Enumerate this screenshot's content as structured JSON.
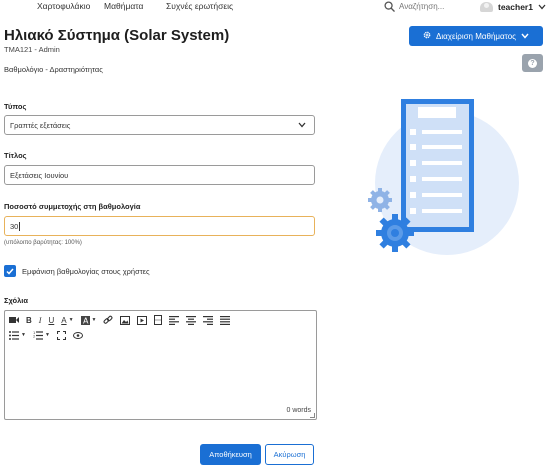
{
  "topnav": {
    "items": [
      {
        "label": "Χαρτοφυλάκιο"
      },
      {
        "label": "Μαθήματα"
      },
      {
        "label": "Συχνές ερωτήσεις"
      }
    ],
    "search_placeholder": "Αναζήτηση...",
    "search_icon": "search-icon",
    "username": "teacher1"
  },
  "header": {
    "title": "Ηλιακό Σύστημα (Solar System)",
    "course_code": "TMA121 - Admin",
    "breadcrumb": "Βαθμολόγιο - Δραστηριότητας",
    "manage_button": "Διαχείριση Μαθήματος",
    "help_icon": "question-icon"
  },
  "form": {
    "type_label": "Τύπος",
    "type_value": "Γραπτές εξετάσεις",
    "title_label": "Τίτλος",
    "title_value": "Εξετάσεις Ιουνίου",
    "weight_label": "Ποσοστό συμμετοχής στη βαθμολογία",
    "weight_value": "30",
    "weight_hint": "(υπόλοιπο βαρύτητας: 100%)",
    "visible_label": "Εμφάνιση βαθμολογίας στους χρήστες",
    "visible_checked": true,
    "comments_label": "Σχόλια",
    "word_count": "0 words"
  },
  "actions": {
    "save": "Αποθήκευση",
    "cancel": "Ακύρωση"
  },
  "colors": {
    "primary": "#1a6fd4",
    "help_button": "#9aa3ad",
    "illustration_circle": "#e5eefb",
    "illustration_blue": "#2f7fe0"
  }
}
